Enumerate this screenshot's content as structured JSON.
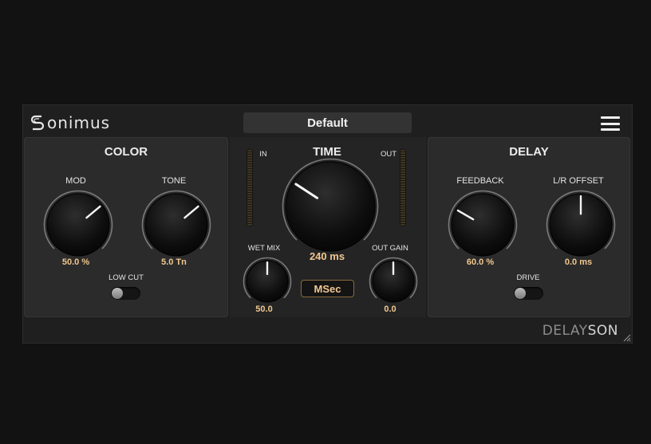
{
  "brand": {
    "logo_text": "onimus",
    "product_prefix": "DELAY",
    "product_suffix": "SON"
  },
  "header": {
    "preset_name": "Default"
  },
  "color_panel": {
    "title": "COLOR",
    "mod": {
      "label": "MOD",
      "value": "50.0 %"
    },
    "tone": {
      "label": "TONE",
      "value": "5.0 Tn"
    },
    "low_cut": {
      "label": "LOW CUT",
      "state": "off"
    }
  },
  "time_panel": {
    "title": "TIME",
    "in_label": "IN",
    "out_label": "OUT",
    "time": {
      "value": "240 ms"
    },
    "wet_mix": {
      "label": "WET MIX",
      "value": "50.0"
    },
    "out_gain": {
      "label": "OUT GAIN",
      "value": "0.0"
    },
    "sync_mode": "MSec"
  },
  "delay_panel": {
    "title": "DELAY",
    "feedback": {
      "label": "FEEDBACK",
      "value": "60.0 %"
    },
    "lr_offset": {
      "label": "L/R OFFSET",
      "value": "0.0 ms"
    },
    "drive": {
      "label": "DRIVE",
      "state": "off"
    }
  },
  "colors": {
    "accent": "#f0c78f",
    "panel": "#2b2b2b",
    "background": "#1f1f1f"
  },
  "icons": {
    "menu": "hamburger-menu-icon",
    "logo": "sonimus-logo-icon",
    "resize": "resize-grip-icon"
  }
}
